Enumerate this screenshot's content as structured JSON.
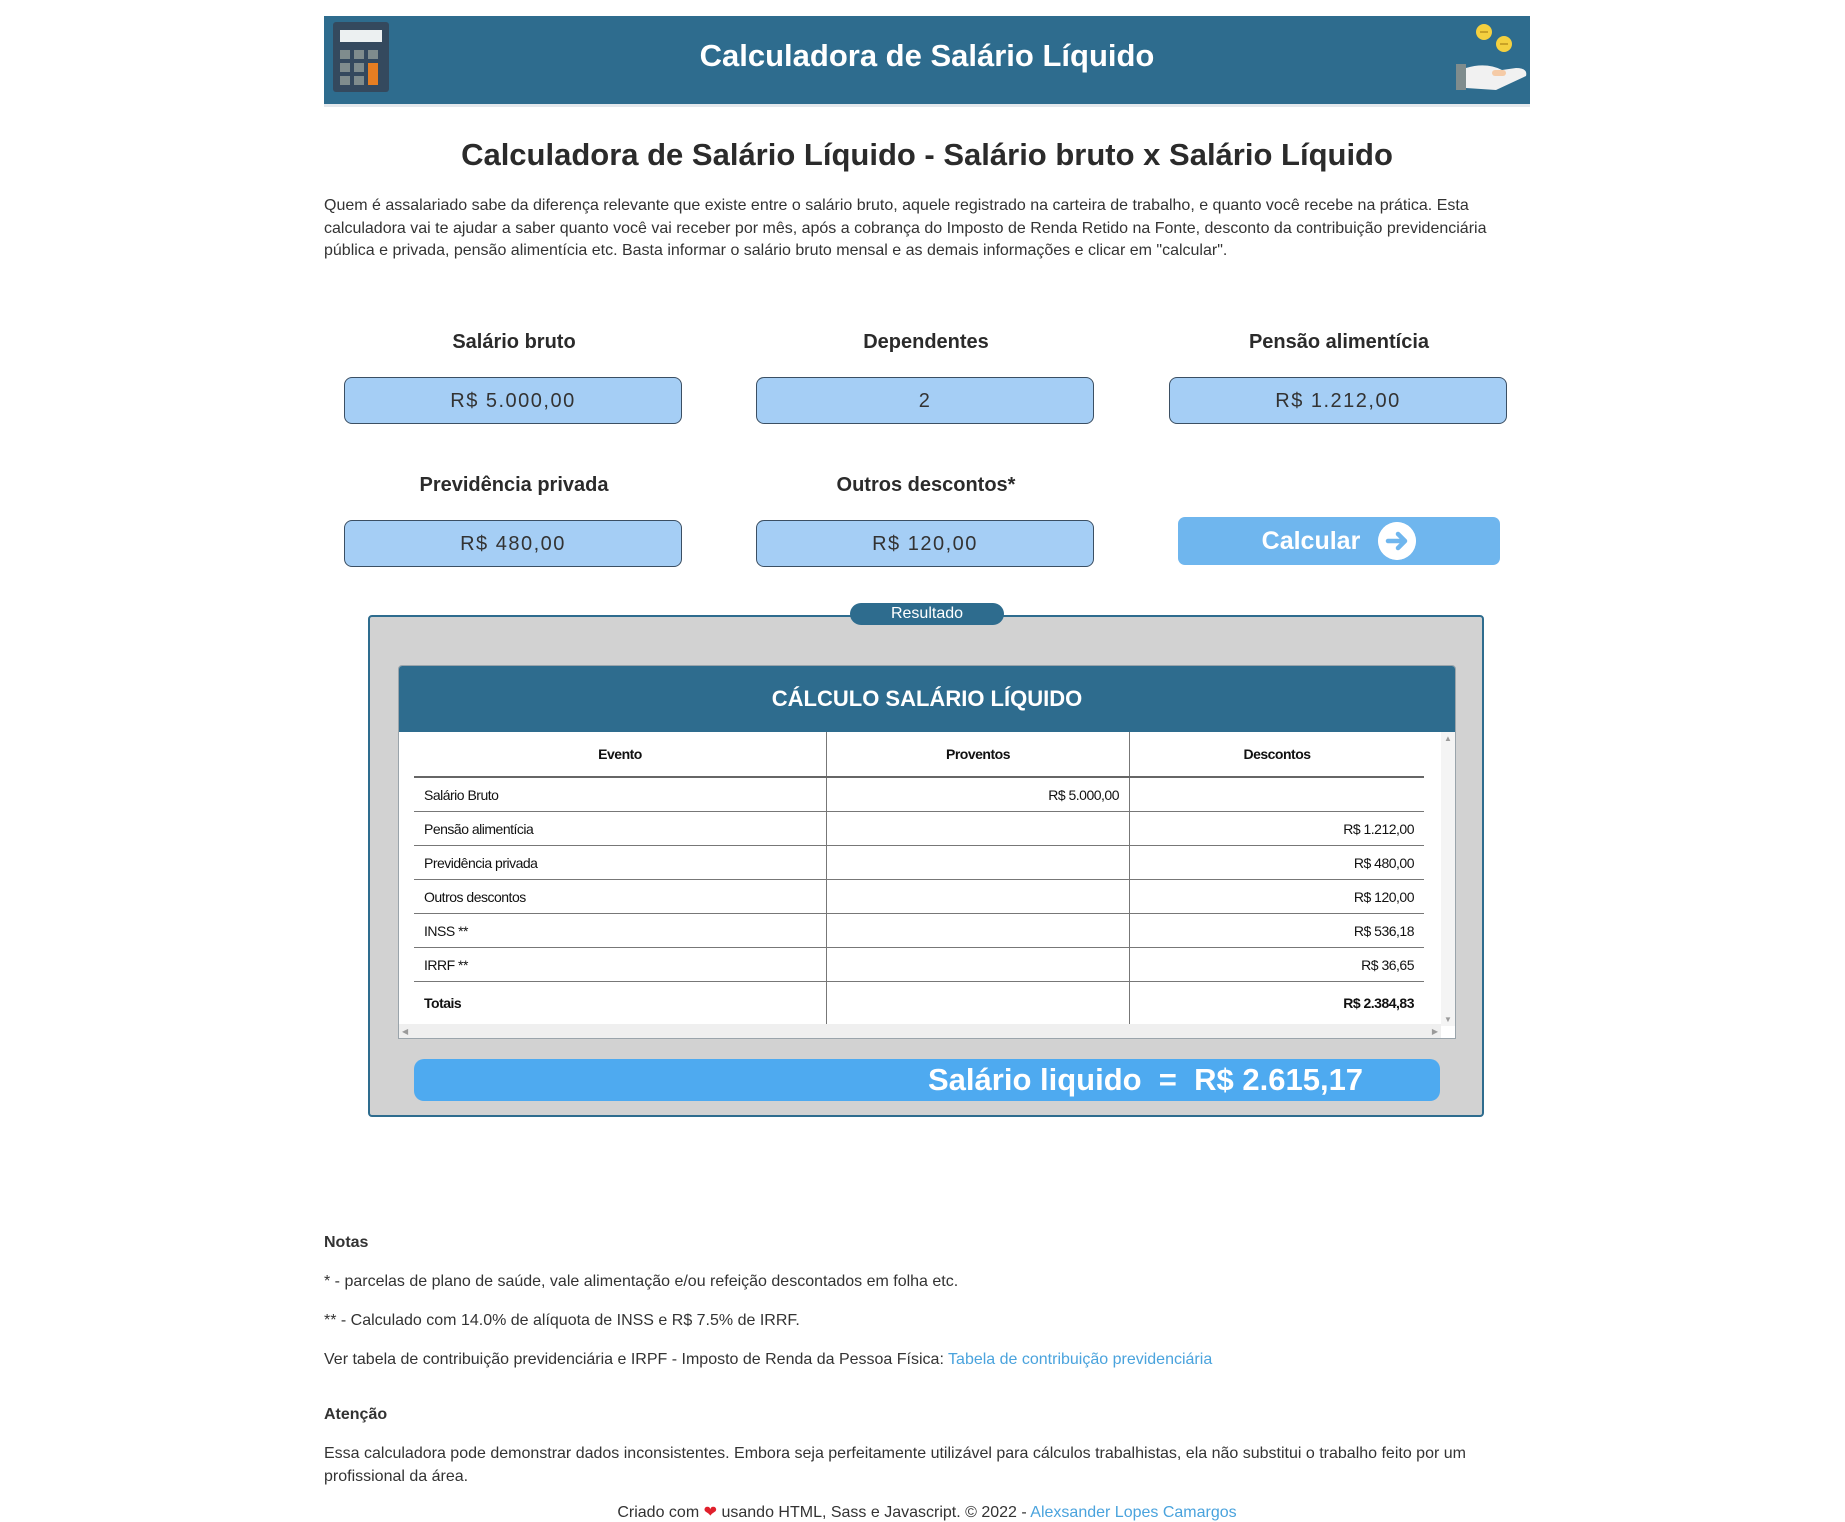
{
  "header": {
    "title": "Calculadora de Salário Líquido"
  },
  "page": {
    "title": "Calculadora de Salário Líquido - Salário bruto x Salário Líquido",
    "intro": "Quem é assalariado sabe da diferença relevante que existe entre o salário bruto, aquele registrado na carteira de trabalho, e quanto você recebe na prática. Esta calculadora vai te ajudar a saber quanto você vai receber por mês, após a cobrança do Imposto de Renda Retido na Fonte, desconto da contribuição previdenciária pública e privada, pensão alimentícia etc. Basta informar o salário bruto mensal e as demais informações e clicar em \"calcular\"."
  },
  "form": {
    "salario_bruto": {
      "label": "Salário bruto",
      "value": "R$ 5.000,00"
    },
    "dependentes": {
      "label": "Dependentes",
      "value": "2"
    },
    "pensao": {
      "label": "Pensão alimentícia",
      "value": "R$ 1.212,00"
    },
    "previdencia": {
      "label": "Previdência privada",
      "value": "R$ 480,00"
    },
    "outros": {
      "label": "Outros descontos*",
      "value": "R$ 120,00"
    },
    "calcular_label": "Calcular"
  },
  "result": {
    "legend": "Resultado",
    "table_title": "CÁLCULO SALÁRIO LÍQUIDO",
    "columns": [
      "Evento",
      "Proventos",
      "Descontos"
    ],
    "rows": [
      {
        "evento": "Salário Bruto",
        "proventos": "R$ 5.000,00",
        "descontos": ""
      },
      {
        "evento": "Pensão alimentícia",
        "proventos": "",
        "descontos": "R$ 1.212,00"
      },
      {
        "evento": "Previdência privada",
        "proventos": "",
        "descontos": "R$ 480,00"
      },
      {
        "evento": "Outros descontos",
        "proventos": "",
        "descontos": "R$ 120,00"
      },
      {
        "evento": "INSS **",
        "proventos": "",
        "descontos": "R$ 536,18"
      },
      {
        "evento": "IRRF **",
        "proventos": "",
        "descontos": "R$ 36,65"
      }
    ],
    "totals": {
      "label": "Totais",
      "proventos": "",
      "descontos": "R$ 2.384,83"
    },
    "net_salary": "Salário liquido  =  R$ 2.615,17"
  },
  "notes": {
    "heading": "Notas",
    "note1": "* - parcelas de plano de saúde, vale alimentação e/ou refeição descontados em folha etc.",
    "note2": "** - Calculado com 14.0% de alíquota de INSS e R$ 7.5% de IRRF.",
    "note3_text": "Ver tabela de contribuição previdenciária e IRPF - Imposto de Renda da Pessoa Física: ",
    "note3_link": "Tabela de contribuição previdenciária",
    "attention_heading": "Atenção",
    "attention_text": "Essa calculadora pode demonstrar dados inconsistentes. Embora seja perfeitamente utilizável para cálculos trabalhistas, ela não substitui o trabalho feito por um profissional da área."
  },
  "footer": {
    "prefix": "Criado com",
    "suffix": "usando HTML, Sass e Javascript. © 2022 -",
    "author": "Alexsander Lopes Camargos"
  },
  "colors": {
    "header_bg": "#2e6c8e",
    "input_bg": "#a5cef5",
    "button_bg": "#6fb6ee",
    "net_bar_bg": "#4eaaf0",
    "link": "#4aa3dd"
  }
}
